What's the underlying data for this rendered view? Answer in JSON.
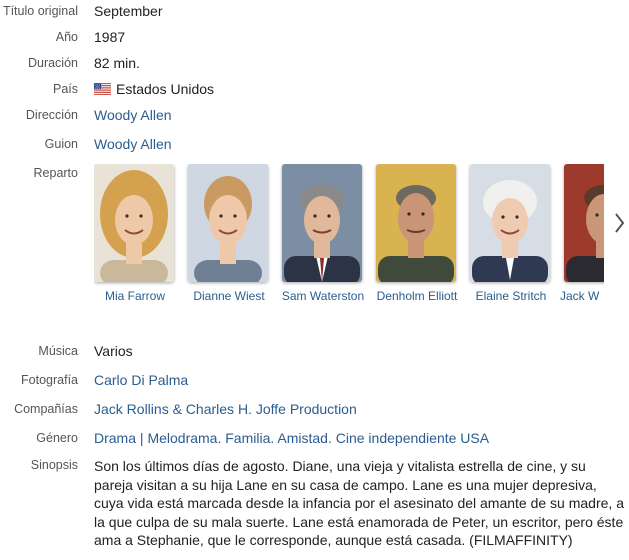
{
  "fields": {
    "original_title": {
      "label": "Título original",
      "value": "September"
    },
    "year": {
      "label": "Año",
      "value": "1987"
    },
    "duration": {
      "label": "Duración",
      "value": "82 min."
    },
    "country": {
      "label": "País",
      "value": "Estados Unidos",
      "flag_icon": "us-flag-icon"
    },
    "direction": {
      "label": "Dirección",
      "value": "Woody Allen"
    },
    "script": {
      "label": "Guion",
      "value": "Woody Allen"
    },
    "cast": {
      "label": "Reparto"
    },
    "music": {
      "label": "Música",
      "value": "Varios"
    },
    "photography": {
      "label": "Fotografía",
      "value": "Carlo Di Palma"
    },
    "companies": {
      "label": "Compañías",
      "value": "Jack Rollins & Charles H. Joffe Production"
    },
    "genre": {
      "label": "Género",
      "links": [
        "Drama",
        "Melodrama",
        "Familia",
        "Amistad",
        "Cine independiente USA"
      ]
    },
    "synopsis": {
      "label": "Sinopsis",
      "text": "Son los últimos días de agosto. Diane, una vieja y vitalista estrella de cine, y su pareja visitan a su hija Lane en su casa de campo. Lane es una mujer depresiva, cuya vida está marcada desde la infancia por el asesinato del amante de su madre, a la que culpa de su mala suerte. Lane está enamorada de Peter, un escritor, pero éste ama a Stephanie, que le corresponde, aunque está casada. (FILMAFFINITY)"
    }
  },
  "cast_members": [
    {
      "name": "Mia Farrow",
      "bg": "#e9e2d6",
      "hair": "#d4a24e",
      "skin": "#eec9a8",
      "shirt": "#c9b89a"
    },
    {
      "name": "Dianne Wiest",
      "bg": "#cfd8e2",
      "hair": "#c99a62",
      "skin": "#efc7a9",
      "shirt": "#6f7f94"
    },
    {
      "name": "Sam Waterston",
      "bg": "#7c8ea3",
      "hair": "#8a8a8a",
      "skin": "#e1b89a",
      "shirt": "#2b3344"
    },
    {
      "name": "Denholm Elliott",
      "bg": "#d8b34f",
      "hair": "#6e6a60",
      "skin": "#c99576",
      "shirt": "#3f4a3a"
    },
    {
      "name": "Elaine Stritch",
      "bg": "#d7dde5",
      "hair": "#f0f0ee",
      "skin": "#efcbb2",
      "shirt": "#2f3a52"
    },
    {
      "name": "Jack W",
      "bg": "#9e3a2c",
      "hair": "#5a3a2a",
      "skin": "#c99678",
      "shirt": "#2a2a30"
    }
  ],
  "colors": {
    "link": "#2a5d8f",
    "label": "#555555",
    "text": "#222222"
  }
}
